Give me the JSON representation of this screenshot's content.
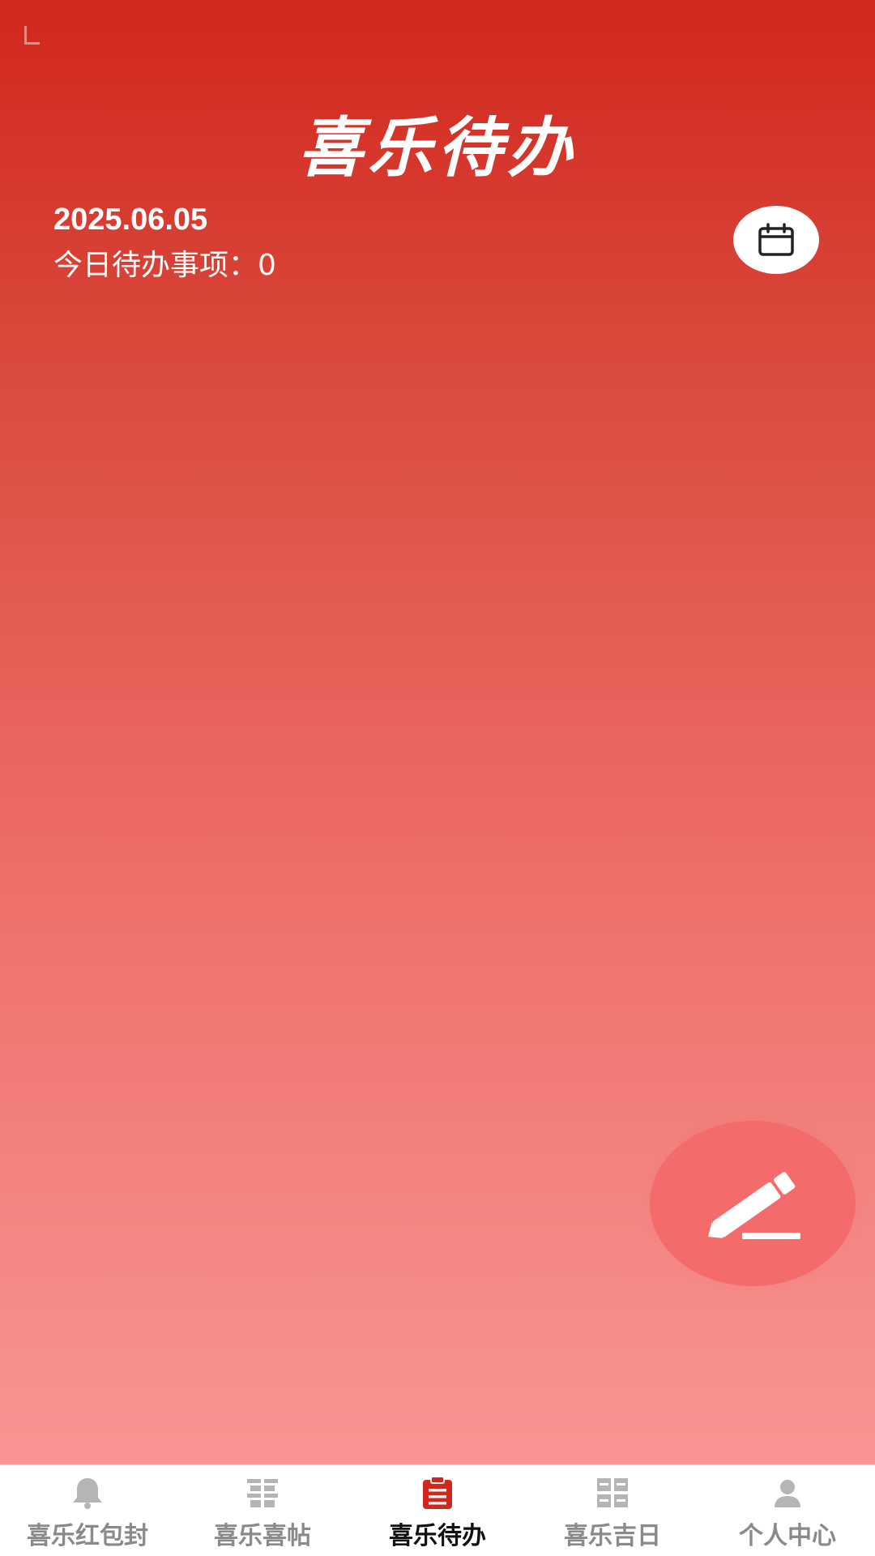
{
  "header": {
    "title": "喜乐待办"
  },
  "summary": {
    "date": "2025.06.05",
    "todo_count_label": "今日待办事项：",
    "todo_count": "0"
  },
  "buttons": {
    "calendar_icon": "calendar-icon",
    "edit_icon": "pencil-icon"
  },
  "tabs": [
    {
      "label": "喜乐红包封",
      "icon": "bell-icon",
      "active": false
    },
    {
      "label": "喜乐喜帖",
      "icon": "double-happiness-icon",
      "active": false
    },
    {
      "label": "喜乐待办",
      "icon": "clipboard-icon",
      "active": true
    },
    {
      "label": "喜乐吉日",
      "icon": "happiness-character-icon",
      "active": false
    },
    {
      "label": "个人中心",
      "icon": "user-icon",
      "active": false
    }
  ],
  "colors": {
    "header_red": "#d2271d",
    "gradient_bottom": "#f89593",
    "fab": "#f46b6b",
    "tab_active_icon": "#d2271d",
    "tab_inactive": "#8a8a8a"
  }
}
